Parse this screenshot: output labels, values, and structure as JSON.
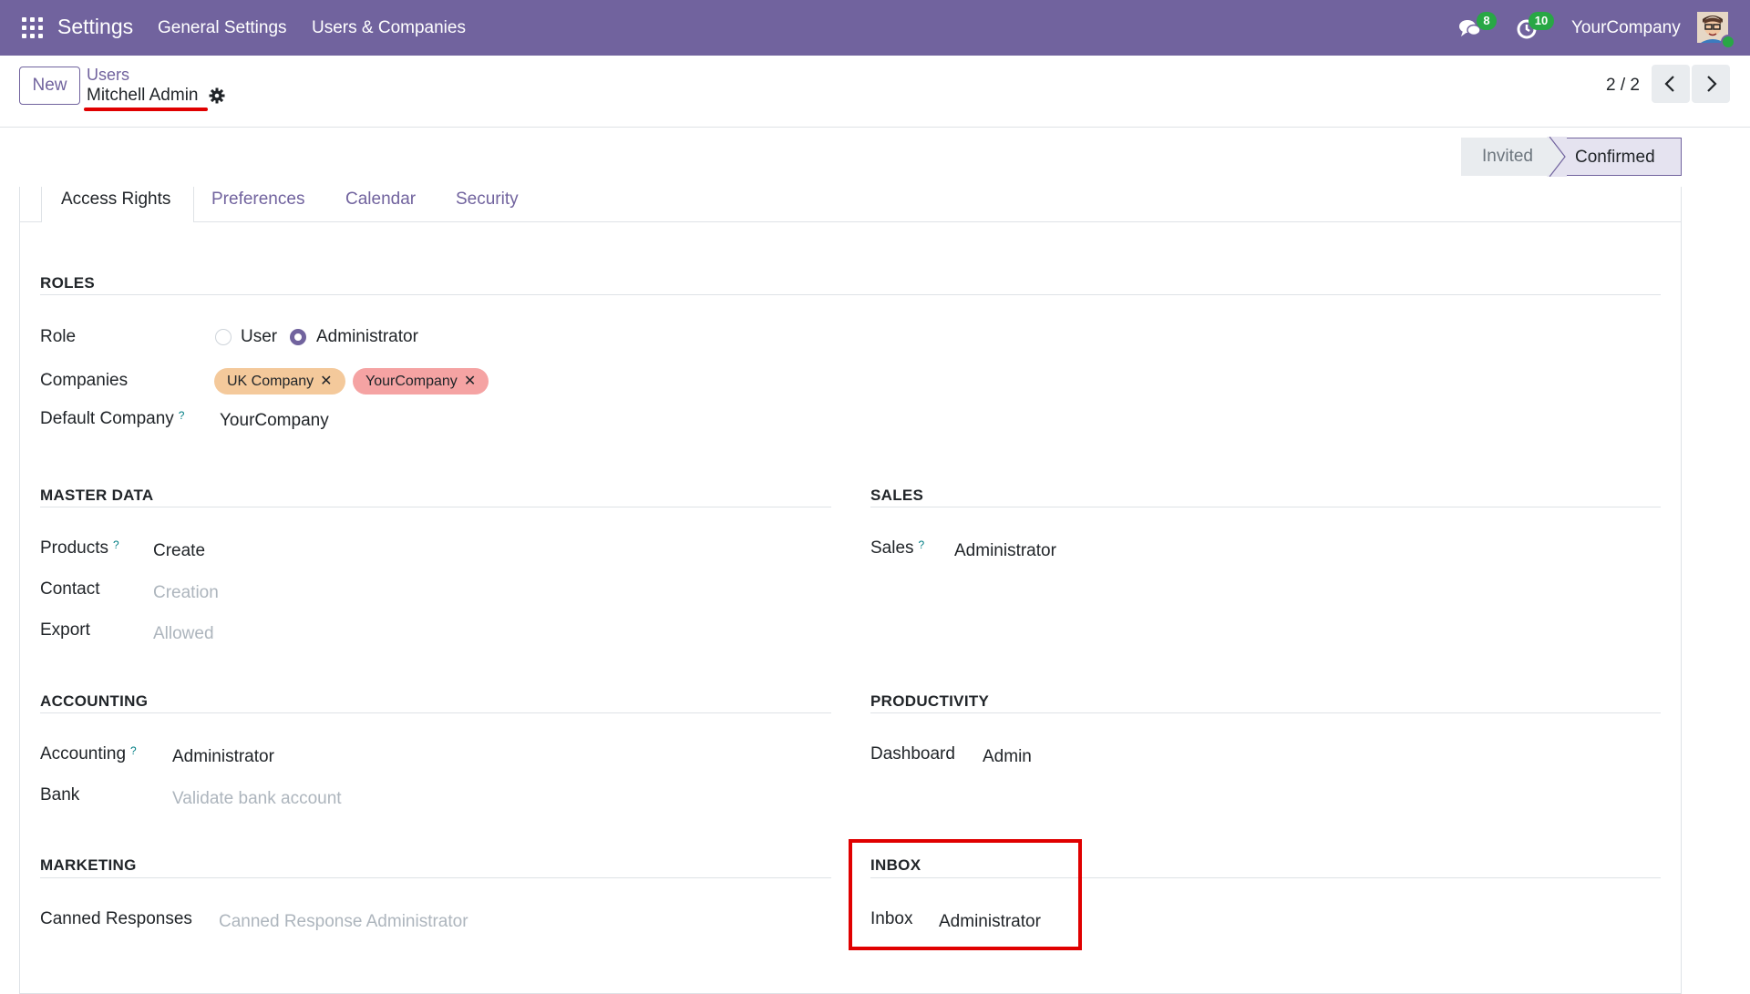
{
  "navbar": {
    "app_name": "Settings",
    "menu": [
      "General Settings",
      "Users & Companies"
    ],
    "messages_count": "8",
    "activities_count": "10",
    "company": "YourCompany",
    "bg_color": "#71639e"
  },
  "control": {
    "new_label": "New",
    "breadcrumb_parent": "Users",
    "record_name": "Mitchell Admin",
    "pager": "2 / 2"
  },
  "status": {
    "steps": [
      "Invited",
      "Confirmed"
    ],
    "current": "Confirmed"
  },
  "tabs": [
    "Access Rights",
    "Preferences",
    "Calendar",
    "Security"
  ],
  "roles": {
    "title": "ROLES",
    "role_label": "Role",
    "role_options": [
      "User",
      "Administrator"
    ],
    "role_selected": "Administrator",
    "companies_label": "Companies",
    "companies": [
      {
        "name": "UK Company",
        "color": "#f4c99b"
      },
      {
        "name": "YourCompany",
        "color": "#f5a3a3"
      }
    ],
    "default_company_label": "Default Company",
    "default_company_help": "?",
    "default_company": "YourCompany"
  },
  "master_data": {
    "title": "MASTER DATA",
    "products_label": "Products",
    "products_help": "?",
    "products_value": "Create",
    "contact_label": "Contact",
    "contact_value": "Creation",
    "export_label": "Export",
    "export_value": "Allowed"
  },
  "sales": {
    "title": "SALES",
    "sales_label": "Sales",
    "sales_help": "?",
    "sales_value": "Administrator"
  },
  "accounting": {
    "title": "ACCOUNTING",
    "accounting_label": "Accounting",
    "accounting_help": "?",
    "accounting_value": "Administrator",
    "bank_label": "Bank",
    "bank_value": "Validate bank account"
  },
  "productivity": {
    "title": "PRODUCTIVITY",
    "dashboard_label": "Dashboard",
    "dashboard_value": "Admin"
  },
  "marketing": {
    "title": "MARKETING",
    "canned_label": "Canned Responses",
    "canned_value": "Canned Response Administrator"
  },
  "inbox": {
    "title": "INBOX",
    "inbox_label": "Inbox",
    "inbox_value": "Administrator"
  },
  "colors": {
    "accent": "#71639e",
    "highlight": "#e00000",
    "help": "#017e84"
  }
}
